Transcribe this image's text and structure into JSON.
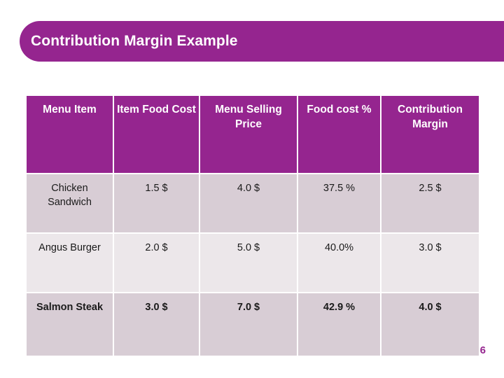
{
  "slide": {
    "title": "Contribution Margin Example",
    "page_number": "6",
    "accent_color": "#95258f",
    "header_text_color": "#ffffff",
    "row_shade_color": "#d8cdd5",
    "row_light_color": "#ece7ea"
  },
  "table": {
    "columns": [
      "Menu Item",
      "Item Food Cost",
      "Menu Selling Price",
      "Food cost %",
      "Contribution Margin"
    ],
    "rows": [
      {
        "menu_item": "Chicken Sandwich",
        "item_food_cost": "1.5 $",
        "menu_selling_price": "4.0 $",
        "food_cost_pct": "37.5 %",
        "contribution_margin": "2.5 $"
      },
      {
        "menu_item": "Angus Burger",
        "item_food_cost": "2.0 $",
        "menu_selling_price": "5.0 $",
        "food_cost_pct": "40.0%",
        "contribution_margin": "3.0 $"
      },
      {
        "menu_item": "Salmon Steak",
        "item_food_cost": "3.0 $",
        "menu_selling_price": "7.0 $",
        "food_cost_pct": "42.9 %",
        "contribution_margin": "4.0 $"
      }
    ]
  }
}
